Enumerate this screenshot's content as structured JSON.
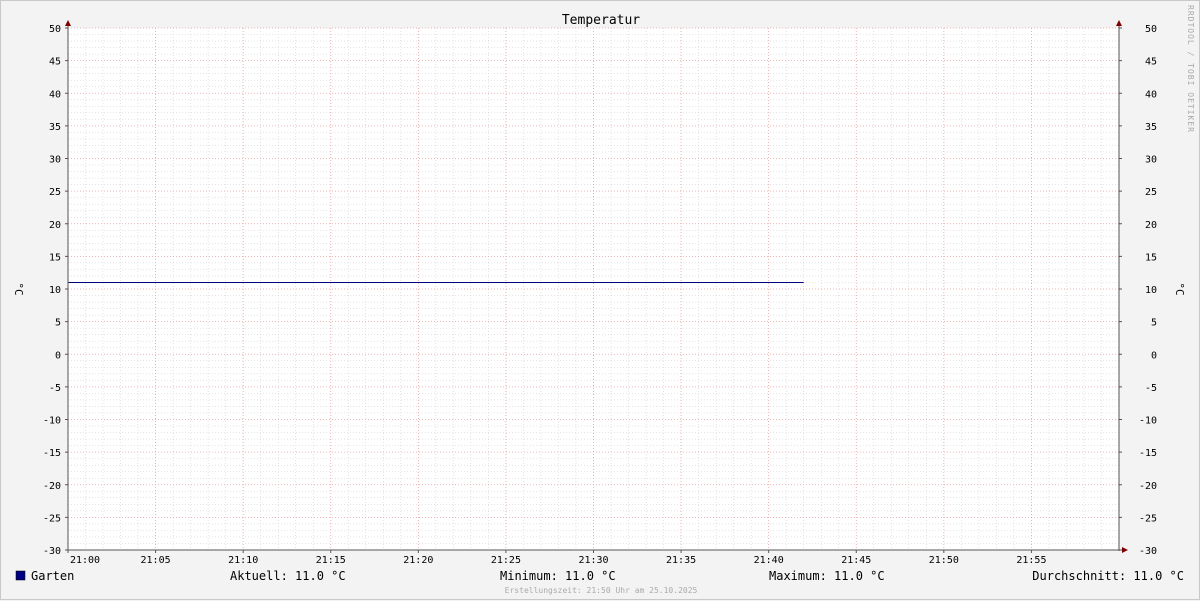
{
  "chart_data": {
    "type": "line",
    "title": "Temperatur",
    "ylabel": "°C",
    "ylabel_right": "°C",
    "ylim": [
      -30,
      50
    ],
    "yticks": [
      -30,
      -25,
      -20,
      -15,
      -10,
      -5,
      0,
      5,
      10,
      15,
      20,
      25,
      30,
      35,
      40,
      45,
      50
    ],
    "xlim": [
      "21:00",
      "22:00"
    ],
    "xticks": [
      "21:00",
      "21:05",
      "21:10",
      "21:15",
      "21:20",
      "21:25",
      "21:30",
      "21:35",
      "21:40",
      "21:45",
      "21:50",
      "21:55"
    ],
    "grid": true,
    "series": [
      {
        "name": "Garten",
        "color": "#000080",
        "x": [
          "21:00",
          "21:42"
        ],
        "values": [
          11.0,
          11.0
        ]
      }
    ],
    "legend": {
      "series_label": "Garten",
      "aktuell": "Aktuell: 11.0 °C",
      "minimum": "Minimum: 11.0 °C",
      "maximum": "Maximum: 11.0 °C",
      "durchschnitt": "Durchschnitt: 11.0 °C"
    },
    "side_label": "RRDTOOL / TOBI OETIKER",
    "footer": "Erstellungszeit: 21:50 Uhr am 25.10.2025"
  },
  "colors": {
    "series": "#000080",
    "major_grid": "#e8a0a0",
    "minor_grid": "#c8c8c8",
    "axis": "#800000"
  }
}
